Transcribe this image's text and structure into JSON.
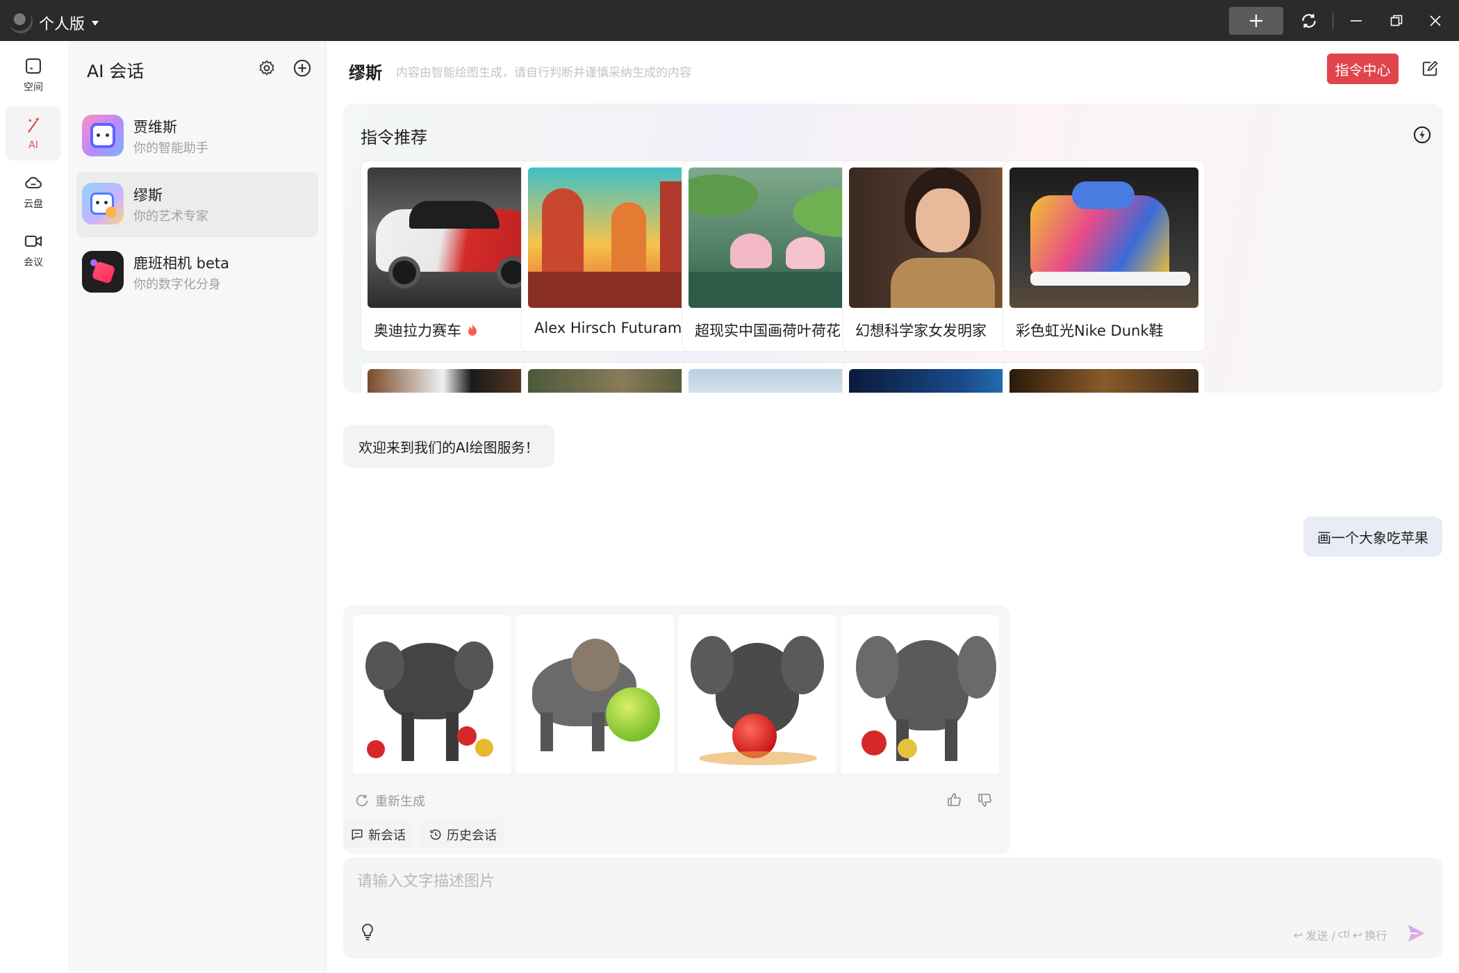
{
  "titlebar": {
    "edition": "个人版",
    "icons": [
      "avatar",
      "plus-icon",
      "sync-icon",
      "minimize-icon",
      "restore-icon",
      "close-icon"
    ]
  },
  "rail": {
    "items": [
      {
        "label": "空间",
        "icon": "space-icon"
      },
      {
        "label": "AI",
        "icon": "magic-wand-icon"
      },
      {
        "label": "云盘",
        "icon": "cloud-icon"
      },
      {
        "label": "会议",
        "icon": "video-icon"
      }
    ]
  },
  "panel": {
    "title": "AI 会话",
    "conversations": [
      {
        "name": "贾维斯",
        "desc": "你的智能助手"
      },
      {
        "name": "缪斯",
        "desc": "你的艺术专家"
      },
      {
        "name": "鹿班相机 beta",
        "desc": "你的数字化分身"
      }
    ]
  },
  "main": {
    "bot_name": "缪斯",
    "notice": "内容由智能绘图生成，请自行判断并谨慎采纳生成的内容",
    "command_center": "指令中心",
    "recommend": {
      "title": "指令推荐",
      "cards": [
        {
          "label": "奥迪拉力赛车",
          "hot": true
        },
        {
          "label": "Alex Hirsch Futurama...",
          "hot": false
        },
        {
          "label": "超现实中国画荷叶荷花",
          "hot": false
        },
        {
          "label": "幻想科学家女发明家",
          "hot": false
        },
        {
          "label": "彩色虹光Nike Dunk鞋",
          "hot": false
        }
      ]
    },
    "welcome": "欢迎来到我们的AI绘图服务！",
    "user_message": "画一个大象吃苹果",
    "regenerate": "重新生成",
    "new_chat": "新会话",
    "history": "历史会话",
    "composer": {
      "placeholder": "请输入文字描述图片",
      "hint_send": "发送 /",
      "hint_ctrl": "ctl",
      "hint_newline": "换行"
    }
  },
  "colors": {
    "accent": "#e0454c",
    "titlebar": "#2b2b2b",
    "panel": "#f7f7f7"
  }
}
